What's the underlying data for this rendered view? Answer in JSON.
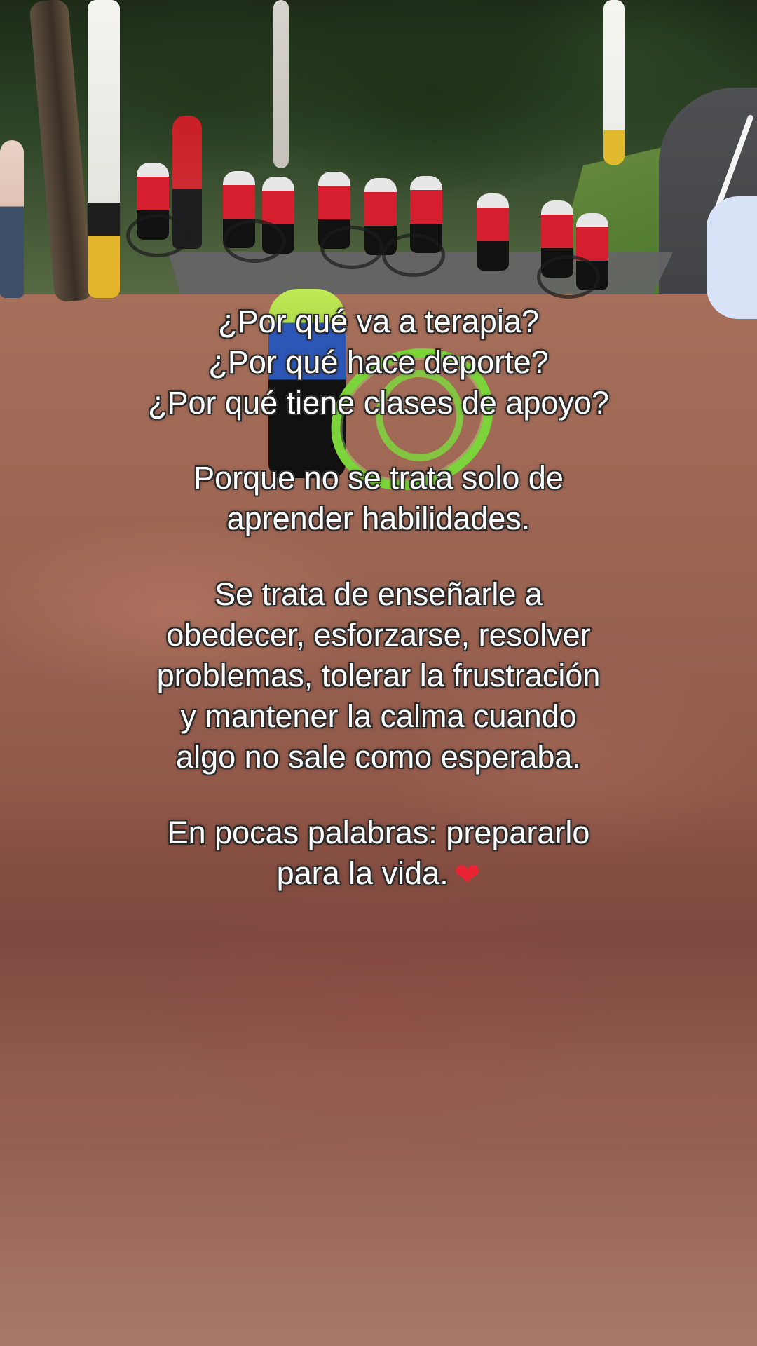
{
  "overlay_text": {
    "intro": [
      "¿Por qué va a terapia?",
      "¿Por qué hace deporte?",
      "¿Por qué tiene clases de apoyo?"
    ],
    "reason": [
      "Porque no se trata solo de",
      "aprender habilidades."
    ],
    "details": [
      "Se trata de enseñarle a",
      "obedecer, esforzarse, resolver",
      "problemas, tolerar la frustración",
      "y mantener la calma cuando",
      "algo no sale como esperaba."
    ],
    "closing": [
      "En pocas palabras: prepararlo",
      "para la vida."
    ],
    "icon": "heart-icon",
    "heart_color": "#ea2433"
  }
}
